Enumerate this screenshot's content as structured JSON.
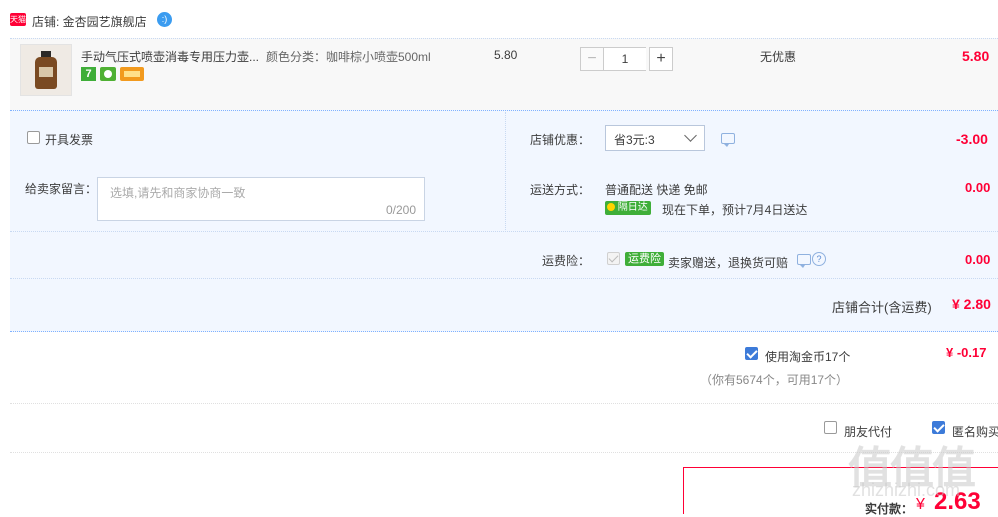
{
  "shop": {
    "badge": "天猫",
    "label": "店铺: 金杏园艺旗舰店"
  },
  "item": {
    "title": "手动气压式喷壶消毒专用压力壶...",
    "sku": "颜色分类：咖啡棕小喷壶500ml",
    "unit_price": "5.80",
    "quantity": "1",
    "promo": "无优惠",
    "subtotal": "5.80",
    "badge_7": "7"
  },
  "invoice": {
    "label": "开具发票"
  },
  "message": {
    "label": "给卖家留言：",
    "placeholder": "选填,请先和商家协商一致",
    "counter": "0/200"
  },
  "shop_discount": {
    "label": "店铺优惠：",
    "selected": "省3元:3",
    "amount": "-3.00"
  },
  "shipping": {
    "label": "运送方式：",
    "method": "普通配送 快递 免邮",
    "tag": "隔日达",
    "eta": "现在下单，预计7月4日送达",
    "amount": "0.00"
  },
  "insurance": {
    "label": "运费险：",
    "tag": "运费险",
    "desc": "卖家赠送，退换货可赔",
    "amount": "0.00"
  },
  "shop_total": {
    "label": "店铺合计(含运费)",
    "amount": "¥ 2.80"
  },
  "coins": {
    "label": "使用淘金币17个",
    "note": "（你有5674个，可用17个）",
    "amount": "¥ -0.17"
  },
  "options": {
    "friend_pay": "朋友代付",
    "anonymous": "匿名购买"
  },
  "payment": {
    "label": "实付款：",
    "currency": "¥",
    "amount": "2.63"
  },
  "watermark": {
    "main": "值值值",
    "sub": "zhizhizhi.com"
  },
  "colors": {
    "accent_red": "#ff0036",
    "tmall_red": "#ff0036",
    "block_bg": "#f2f7ff",
    "check_blue": "#3d7bd9",
    "tag_green": "#3fae39"
  }
}
